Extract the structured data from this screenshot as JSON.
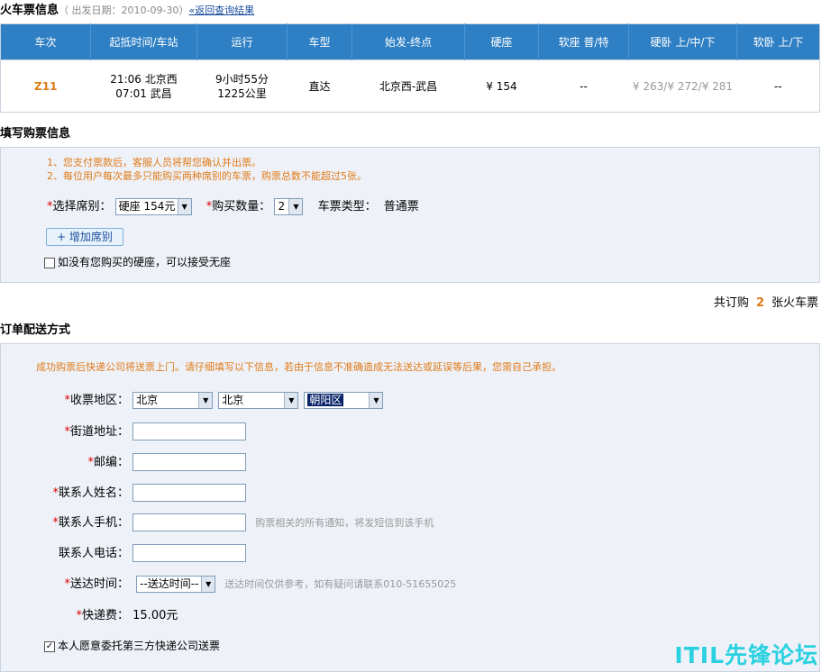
{
  "header": {
    "title": "火车票信息",
    "date_prefix": "（ 出发日期：",
    "date": "2010-09-30",
    "date_suffix": "）",
    "back_link": "«返回查询结果"
  },
  "train_table": {
    "columns": [
      "车次",
      "起抵时间/车站",
      "运行",
      "车型",
      "始发-终点",
      "硬座",
      "软座  普/特",
      "硬卧  上/中/下",
      "软卧  上/下"
    ],
    "row": {
      "train_no": "Z11",
      "depart": "21:06 北京西",
      "arrive": "07:01 武昌",
      "duration": "9小时55分",
      "distance": "1225公里",
      "type": "直达",
      "route": "北京西-武昌",
      "hard_seat": "¥ 154",
      "soft_seat": "--",
      "hard_sleeper": "¥ 263/¥ 272/¥ 281",
      "soft_sleeper": "--"
    }
  },
  "purchase": {
    "section_title": "填写购票信息",
    "notice1": "1、您支付票款后，客服人员将帮您确认并出票。",
    "notice2": "2、每位用户每次最多只能购买两种席别的车票，购票总数不能超过5张。",
    "seat_label": "选择席别：",
    "seat_value": "硬座 154元",
    "qty_label": "购买数量：",
    "qty_value": "2",
    "ticket_type_label": "车票类型：",
    "ticket_type_value": "普通票",
    "add_button": "+ 增加席别",
    "standing_label": "如没有您购买的硬座，可以接受无座"
  },
  "total": {
    "prefix": "共订购",
    "count": "2",
    "suffix": "张火车票"
  },
  "delivery": {
    "section_title": "订单配送方式",
    "notice": "成功购票后快递公司将送票上门。请仔细填写以下信息，若由于信息不准确造成无法送达或延误等后果，您需自己承担。",
    "region_label": "收票地区：",
    "province": "北京",
    "city": "北京",
    "district": "朝阳区",
    "street_label": "街道地址：",
    "zip_label": "邮编：",
    "name_label": "联系人姓名：",
    "mobile_label": "联系人手机：",
    "mobile_hint": "购票相关的所有通知，将发短信到该手机",
    "phone_label": "联系人电话：",
    "time_label": "送达时间：",
    "time_value": "--送达时间--",
    "time_hint": "送达时间仅供参考，如有疑问请联系010-51655025",
    "fee_label": "快递费：",
    "fee_value": "15.00元",
    "agree_label": "本人愿意委托第三方快递公司送票"
  },
  "watermark": "ITIL先锋论坛"
}
